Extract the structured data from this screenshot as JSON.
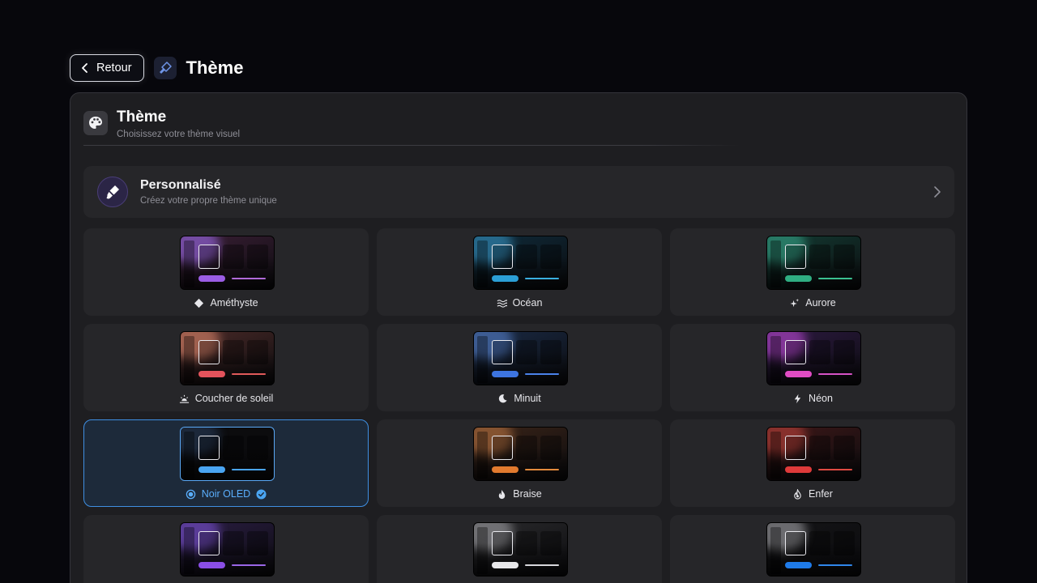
{
  "header": {
    "back_label": "Retour",
    "title": "Thème"
  },
  "panel": {
    "title": "Thème",
    "subtitle": "Choisissez votre thème visuel"
  },
  "custom": {
    "title": "Personnalisé",
    "subtitle": "Créez votre propre thème unique"
  },
  "themes": [
    {
      "label": "Améthyste",
      "icon": "diamond-icon",
      "bg": "#3a1f35",
      "glow": "#8a5cc9",
      "pill": "#9b5de5",
      "line": "#b06ad8",
      "selected": false
    },
    {
      "label": "Océan",
      "icon": "waves-icon",
      "bg": "#0f2b3a",
      "glow": "#2f7fa8",
      "pill": "#2b9fd6",
      "line": "#3ab0e0",
      "selected": false
    },
    {
      "label": "Aurore",
      "icon": "sparkles-icon",
      "bg": "#143b33",
      "glow": "#2f8f77",
      "pill": "#2fae82",
      "line": "#3bc090",
      "selected": false
    },
    {
      "label": "Coucher de soleil",
      "icon": "sunset-icon",
      "bg": "#4a2a28",
      "glow": "#c0745e",
      "pill": "#e4535c",
      "line": "#e05a5a",
      "selected": false
    },
    {
      "label": "Minuit",
      "icon": "moon-icon",
      "bg": "#1a2a44",
      "glow": "#4a6fb0",
      "pill": "#3d74e0",
      "line": "#4a82ea",
      "selected": false
    },
    {
      "label": "Néon",
      "icon": "bolt-icon",
      "bg": "#2c1a40",
      "glow": "#a03fb8",
      "pill": "#e04cc4",
      "line": "#d652c6",
      "selected": false
    },
    {
      "label": "Noir OLED",
      "icon": "oled-icon",
      "bg": "#0c0c0e",
      "glow": "#22324a",
      "pill": "#4aa5f2",
      "line": "#4aa5f2",
      "selected": true
    },
    {
      "label": "Braise",
      "icon": "flame-icon",
      "bg": "#3a2418",
      "glow": "#a0643a",
      "pill": "#e27a2e",
      "line": "#e38a3c",
      "selected": false
    },
    {
      "label": "Enfer",
      "icon": "fire-icon",
      "bg": "#3d1818",
      "glow": "#a33a34",
      "pill": "#e03a3a",
      "line": "#e04a42",
      "selected": false
    },
    {
      "label": "",
      "icon": "",
      "bg": "#2a1d42",
      "glow": "#6c48b8",
      "pill": "#8a4ee6",
      "line": "#9a66e6",
      "selected": false
    },
    {
      "label": "",
      "icon": "",
      "bg": "#2a2a2c",
      "glow": "#8a8a8e",
      "pill": "#e8e8ea",
      "line": "#d8d8dc",
      "selected": false
    },
    {
      "label": "",
      "icon": "",
      "bg": "#141416",
      "glow": "#8a8a8e",
      "pill": "#1f7bea",
      "line": "#2f86ea",
      "selected": false
    }
  ]
}
